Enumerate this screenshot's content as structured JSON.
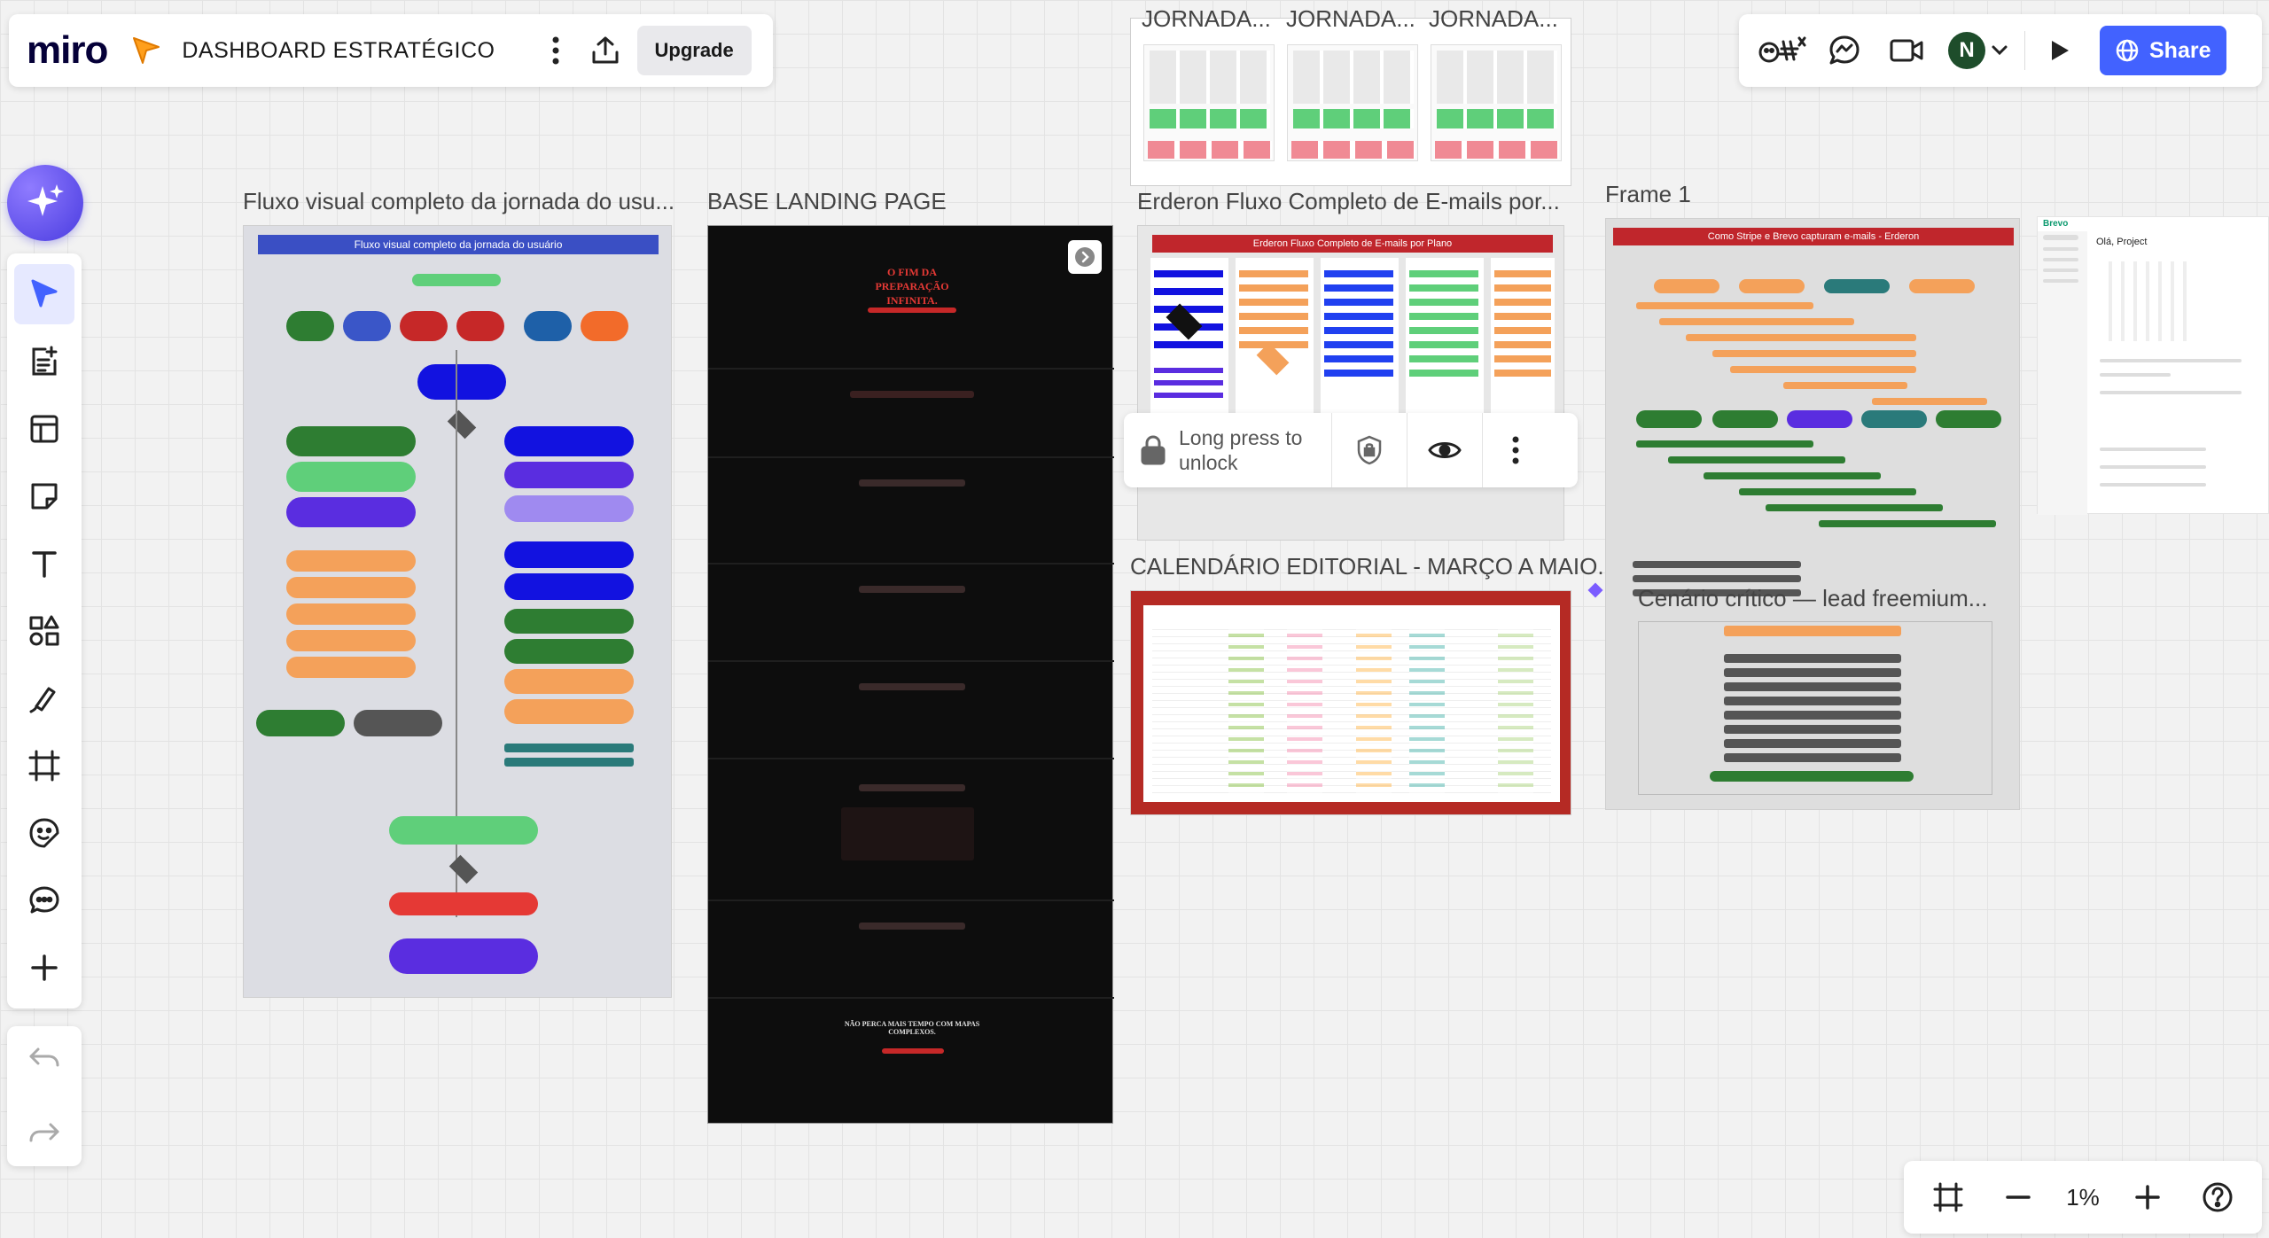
{
  "app": {
    "logo": "miro",
    "board_title": "DASHBOARD ESTRATÉGICO",
    "upgrade_label": "Upgrade",
    "share_label": "Share",
    "avatar_initial": "N"
  },
  "lock_popup": {
    "text": "Long press to unlock"
  },
  "zoom": {
    "level": "1%"
  },
  "frames": {
    "jornada_1": "JORNADA...",
    "jornada_2": "JORNADA...",
    "jornada_3": "JORNADA...",
    "fluxo_visual": "Fluxo visual completo da jornada do usu...",
    "fluxo_visual_header": "Fluxo visual completo da jornada do usuário",
    "landing": "BASE LANDING PAGE",
    "landing_headline": "O FIM DA PREPARAÇÃO INFINITA.",
    "landing_footer": "NÃO PERCA MAIS TEMPO COM MAPAS COMPLEXOS.",
    "emails": "Erderon Fluxo Completo de E-mails por...",
    "emails_header": "Erderon Fluxo Completo de E-mails por Plano",
    "calendario": "CALENDÁRIO EDITORIAL - MARÇO A MAIO...",
    "frame1": "Frame 1",
    "frame1_header": "Como Stripe e Brevo capturam e-mails - Erderon",
    "cenario": "Cenário crítico — lead freemium...",
    "brevo_title": "Olá, Project",
    "brevo_logo": "Brevo"
  },
  "colors": {
    "accent": "#4262ff",
    "miro_dark": "#050038",
    "ai_purple": "#5b4cf0",
    "red_header": "#c0262c",
    "blue_header": "#3a4fc4"
  }
}
